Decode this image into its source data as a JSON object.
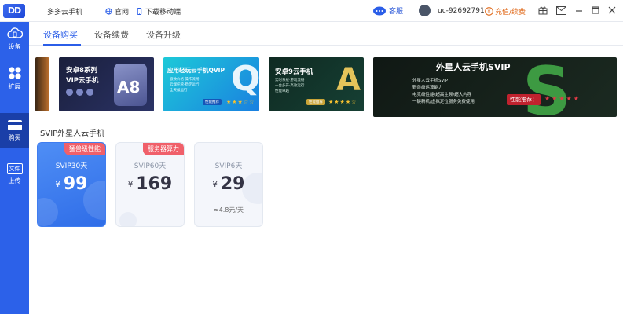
{
  "window": {
    "title": "多多云手机",
    "links": [
      "官网",
      "下载移动端"
    ],
    "support": "客服",
    "user": "uc-92692791",
    "recharge": "充值/续费",
    "colors": {
      "brand": "#2c61e9",
      "sidebar_active": "#1a3fa8",
      "accent_orange": "#e06a1b",
      "badge_red": "#f0606a"
    }
  },
  "sidebar": {
    "items": [
      {
        "label": "设备",
        "icon": "cloud-device-icon"
      },
      {
        "label": "扩展",
        "icon": "extension-icon"
      },
      {
        "label": "购买",
        "icon": "card-icon",
        "active": true
      },
      {
        "label": "文件上传",
        "icon": "file-icon"
      }
    ]
  },
  "tabs": [
    {
      "label": "设备购买",
      "active": true
    },
    {
      "label": "设备续费"
    },
    {
      "label": "设备升级"
    }
  ],
  "banners": [
    {
      "title": "安卓8系列",
      "subtitle": "VIP云手机",
      "big": "A8"
    },
    {
      "title": "应用轻玩云手机QVIP",
      "big": "Q",
      "lines": [
        "极致价格·操作流畅",
        "云端托管·稳定运行",
        "全天候运行"
      ],
      "tag": "性能推荐"
    },
    {
      "title": "安卓9云手机",
      "big": "A",
      "lines": [
        "实时系统·游戏流畅",
        "一台多开·高效运行",
        "性能卓越"
      ],
      "tag": "性能推荐"
    },
    {
      "title": "外星人云手机SVIP",
      "big": "S",
      "lines": [
        "外星人云手机SVIP",
        "野兽级运算能力",
        "电竞级性能/超高主频/超大内存",
        "一键新机/虚拟定位服务免费使用"
      ],
      "tag": "性能推荐："
    }
  ],
  "section_title": "SVIP外星人云手机",
  "cards": [
    {
      "badge": "猛兽级性能",
      "name": "SVIP30天",
      "currency": "¥",
      "price": "99",
      "active": true
    },
    {
      "badge": "服务器算力",
      "name": "SVIP60天",
      "currency": "¥",
      "price": "169"
    },
    {
      "name": "SVIP6天",
      "currency": "¥",
      "price": "29",
      "per_day": "≈4.8元/天"
    }
  ]
}
